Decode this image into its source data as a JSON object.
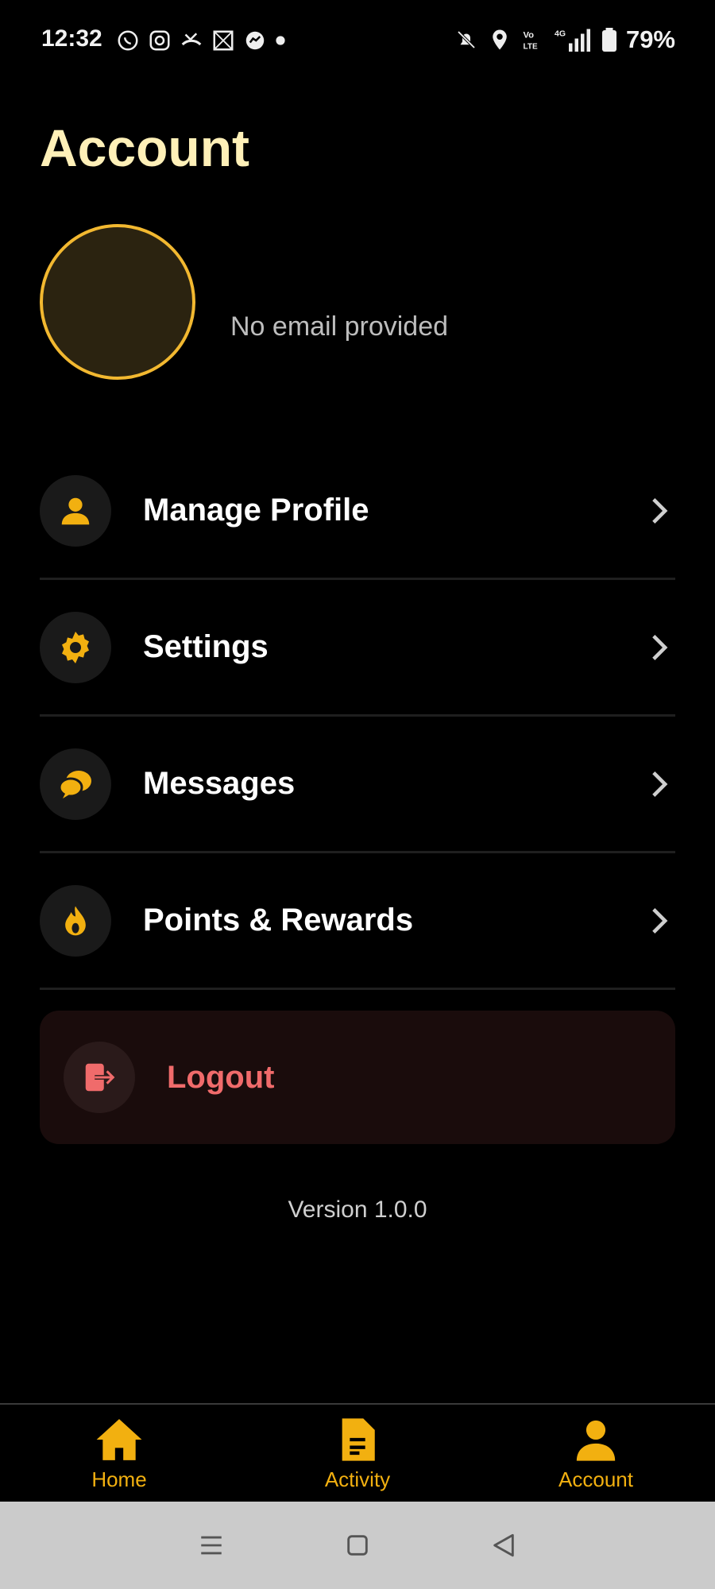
{
  "status_bar": {
    "time": "12:32",
    "battery_text": "79%",
    "left_icons": [
      "whatsapp-icon",
      "instagram-icon",
      "missed-call-icon",
      "gallery-icon",
      "messenger-icon",
      "dot-icon"
    ],
    "right_icons": [
      "bell-off-icon",
      "location-icon",
      "volte-icon",
      "signal-4g-icon",
      "battery-icon"
    ]
  },
  "header": {
    "title": "Account"
  },
  "profile": {
    "email": "No email provided"
  },
  "menu": {
    "items": [
      {
        "label": "Manage Profile",
        "icon": "person-icon"
      },
      {
        "label": "Settings",
        "icon": "gear-icon"
      },
      {
        "label": "Messages",
        "icon": "chat-bubbles-icon"
      },
      {
        "label": "Points & Rewards",
        "icon": "flame-icon"
      }
    ]
  },
  "logout": {
    "label": "Logout",
    "icon": "logout-icon"
  },
  "version": "Version 1.0.0",
  "bottom_nav": {
    "items": [
      {
        "label": "Home",
        "icon": "home-icon"
      },
      {
        "label": "Activity",
        "icon": "document-icon"
      },
      {
        "label": "Account",
        "icon": "person-icon"
      }
    ]
  },
  "colors": {
    "accent": "#f2b010",
    "title": "#fff0b8",
    "danger": "#f06b6b",
    "background": "#000000"
  }
}
